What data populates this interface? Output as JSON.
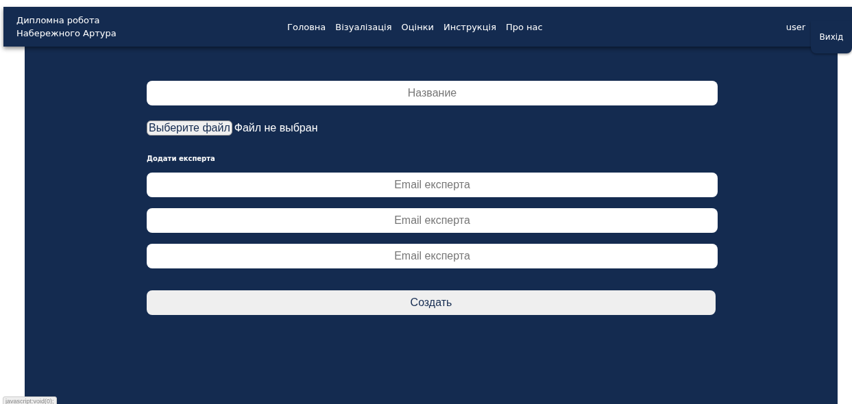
{
  "brand": {
    "line_1": "Дипломна робота",
    "line_2": "Набережного Артура"
  },
  "nav": [
    {
      "label": "Головна"
    },
    {
      "label": "Візуалізація"
    },
    {
      "label": "Оцінки"
    },
    {
      "label": "Инструкція"
    },
    {
      "label": "Про нас"
    }
  ],
  "user": "user",
  "logout": "Вихід",
  "form": {
    "name_field": {
      "placeholder": "Название"
    },
    "file": {
      "button": "Выберите файл",
      "status": "Файл не выбран"
    },
    "experts_label": "Додати експерта",
    "expert_fields": [
      {
        "placeholder": "Email експерта"
      },
      {
        "placeholder": "Email експерта"
      },
      {
        "placeholder": "Email експерта"
      }
    ],
    "submit": "Создать"
  },
  "status_bar": "javascript:void(0);"
}
